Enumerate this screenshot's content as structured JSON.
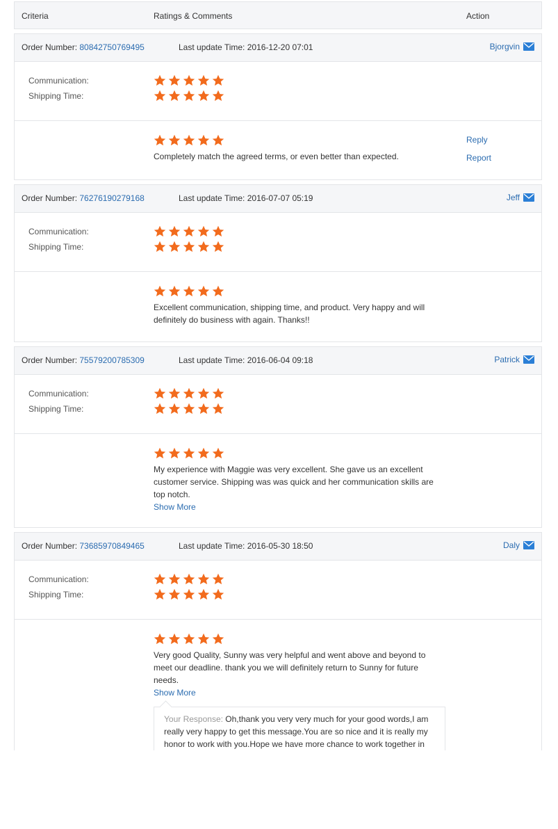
{
  "header": {
    "criteria": "Criteria",
    "ratings": "Ratings & Comments",
    "action": "Action"
  },
  "labels": {
    "order_number": "Order Number:",
    "last_update": "Last update Time:",
    "communication": "Communication:",
    "shipping": "Shipping Time:",
    "reply": "Reply",
    "report": "Report",
    "show_more": "Show More",
    "your_response": "Your Response:"
  },
  "star_color": "#f26b1d",
  "orders": [
    {
      "number": "80842750769495",
      "updated": "2016-12-20 07:01",
      "buyer": "Bjorgvin",
      "communication_stars": 5,
      "shipping_stars": 5,
      "comment_stars": 5,
      "comment": "Completely match the agreed terms, or even better than expected."
    },
    {
      "number": "76276190279168",
      "updated": "2016-07-07 05:19",
      "buyer": "Jeff",
      "communication_stars": 5,
      "shipping_stars": 5,
      "comment_stars": 5,
      "comment": "Excellent communication, shipping time, and product. Very happy and will definitely do business with again. Thanks!!"
    },
    {
      "number": "75579200785309",
      "updated": "2016-06-04 09:18",
      "buyer": "Patrick",
      "communication_stars": 5,
      "shipping_stars": 5,
      "comment_stars": 5,
      "comment": "My experience with Maggie was very excellent. She gave us an excellent customer service. Shipping was was quick and her communication skills are top notch."
    },
    {
      "number": "73685970849465",
      "updated": "2016-05-30 18:50",
      "buyer": "Daly",
      "communication_stars": 5,
      "shipping_stars": 5,
      "comment_stars": 5,
      "comment": "Very good Quality, Sunny was very helpful and went above and beyond to meet our deadline. thank you we will definitely return to Sunny for future needs.",
      "response": "Oh,thank you very very much for your good words,I am really very happy to get this message.You are so nice and it is really my honor to work with you.Hope we have more chance to work together in the next time. Also if you need any help in China, feel free to contact me."
    }
  ]
}
